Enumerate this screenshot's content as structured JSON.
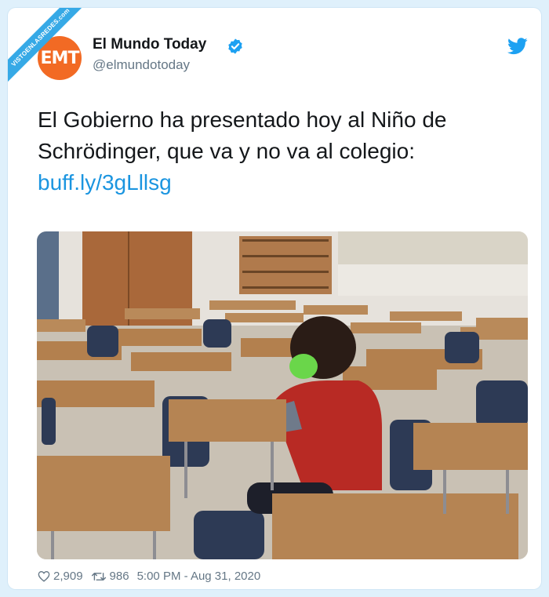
{
  "watermark": {
    "text": "VISTOENLASREDES",
    "suffix": ".com"
  },
  "author": {
    "avatar_text": "EMT",
    "display_name": "El Mundo Today",
    "handle": "@elmundotoday",
    "verified": true,
    "avatar_color": "#f26a24"
  },
  "platform_icon": "twitter-bird-icon",
  "tweet": {
    "text": "El Gobierno ha presentado hoy al Niño de Schrödinger, que va y no va al colegio:",
    "link": "buff.ly/3gLllsg"
  },
  "media": {
    "alt_icon": "classroom-photo"
  },
  "footer": {
    "likes": "2,909",
    "retweets": "986",
    "timestamp": "5:00 PM - Aug 31, 2020"
  },
  "colors": {
    "link": "#1b95e0",
    "verified": "#1da1f2",
    "twitter": "#1da1f2",
    "background": "#dff0fb"
  }
}
